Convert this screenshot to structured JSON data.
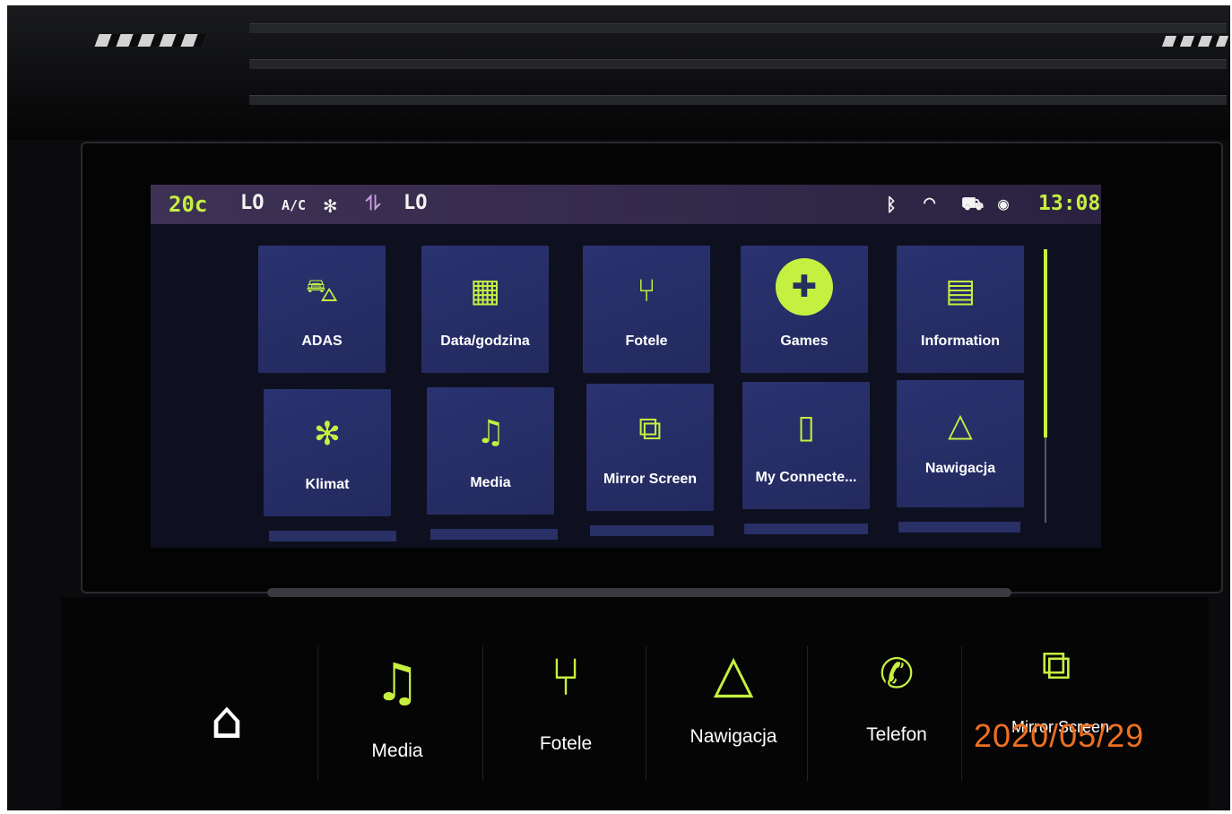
{
  "status_bar": {
    "temperature": "20c",
    "fan_left": "LO",
    "ac": "A/C",
    "fan_right": "LO",
    "time": "13:08",
    "icons": [
      "fan-icon",
      "seat-heat-icon",
      "bluetooth-icon",
      "wifi-icon",
      "car-connect-icon",
      "location-icon"
    ]
  },
  "apps": [
    {
      "label": "ADAS",
      "icon": "car-icon"
    },
    {
      "label": "Data/godzina",
      "icon": "calendar-clock-icon"
    },
    {
      "label": "Fotele",
      "icon": "seat-icon"
    },
    {
      "label": "Games",
      "icon": "gamepad-icon"
    },
    {
      "label": "Information",
      "icon": "document-icon"
    },
    {
      "label": "Klimat",
      "icon": "climate-icon"
    },
    {
      "label": "Media",
      "icon": "music-note-icon"
    },
    {
      "label": "Mirror Screen",
      "icon": "mirror-screen-icon"
    },
    {
      "label": "My Connecte...",
      "icon": "phone-signal-icon"
    },
    {
      "label": "Nawigacja",
      "icon": "navigation-arrow-icon"
    }
  ],
  "shortcut_bar": {
    "home_icon": "home-icon",
    "items": [
      {
        "label": "Media",
        "icon": "music-note-icon"
      },
      {
        "label": "Fotele",
        "icon": "seat-icon"
      },
      {
        "label": "Nawigacja",
        "icon": "navigation-arrow-icon"
      },
      {
        "label": "Telefon",
        "icon": "phone-icon"
      },
      {
        "label": "Mirror Screen",
        "icon": "mirror-screen-icon"
      }
    ]
  },
  "date_stamp": "2020/05/29",
  "colors": {
    "accent": "#c6f040",
    "tile": "#2a3270",
    "stamp": "#ee7020"
  }
}
